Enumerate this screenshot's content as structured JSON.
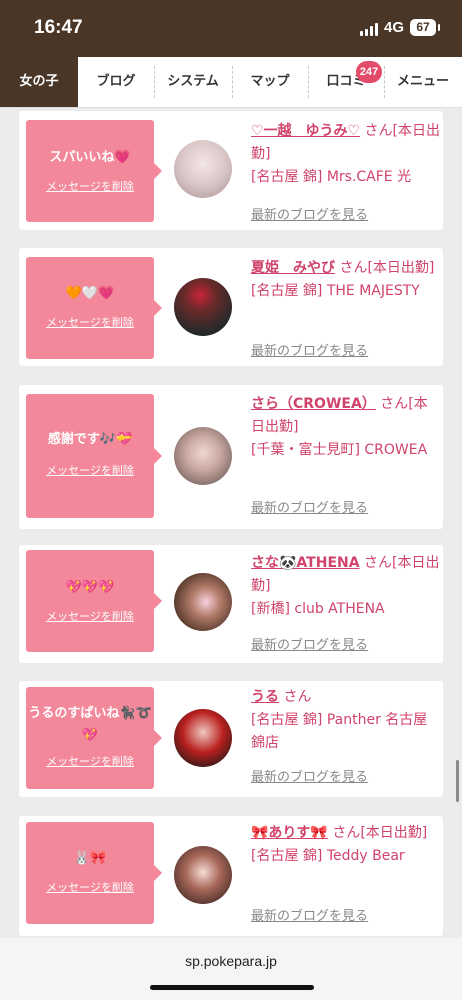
{
  "status": {
    "time": "16:47",
    "network": "4G",
    "battery": "67"
  },
  "nav": {
    "tabs": [
      {
        "label": "女の子"
      },
      {
        "label": "ブログ"
      },
      {
        "label": "システム"
      },
      {
        "label": "マップ"
      },
      {
        "label": "口コミ",
        "badge": "247"
      },
      {
        "label": "メニュー"
      }
    ]
  },
  "cards": [
    {
      "message": "スパいいね💗",
      "delete_label": "メッセージを削除",
      "name": "♡一越　ゆうみ♡",
      "suffix": " さん[本日出勤]",
      "shop": "[名古屋 錦] Mrs.CAFE 光",
      "blog_link": "最新のブログを見る"
    },
    {
      "message": "🧡🤍💗",
      "delete_label": "メッセージを削除",
      "name": "夏姫　みやび",
      "suffix": " さん[本日出勤]",
      "shop": "[名古屋 錦] THE MAJESTY",
      "blog_link": "最新のブログを見る"
    },
    {
      "message": "感謝です🎶💝",
      "delete_label": "メッセージを削除",
      "name": "さら（CROWEA）",
      "suffix": " さん[本日出勤]",
      "shop": "[千葉・富士見町] CROWEA",
      "blog_link": "最新のブログを見る"
    },
    {
      "message": "💖💖💖",
      "delete_label": "メッセージを削除",
      "name": "さな🐼ATHENA",
      "suffix": " さん[本日出勤]",
      "shop": "[新橋] club ATHENA",
      "blog_link": "最新のブログを見る"
    },
    {
      "message": "うるのすぱいね🐈‍⬛➰💖",
      "delete_label": "メッセージを削除",
      "name": "うる",
      "suffix": " さん",
      "shop": "[名古屋 錦] Panther 名古屋錦店",
      "blog_link": "最新のブログを見る"
    },
    {
      "message": "🐰🎀",
      "delete_label": "メッセージを削除",
      "name": "🎀ありす🎀",
      "suffix": " さん[本日出勤]",
      "shop": "[名古屋 錦] Teddy Bear",
      "blog_link": "最新のブログを見る"
    }
  ],
  "browser": {
    "url": "sp.pokepara.jp"
  },
  "colors": {
    "header_brown": "#4a3626",
    "message_pink": "#f3889a",
    "name_pink": "#d0436a",
    "badge_red": "#e44b6b"
  }
}
